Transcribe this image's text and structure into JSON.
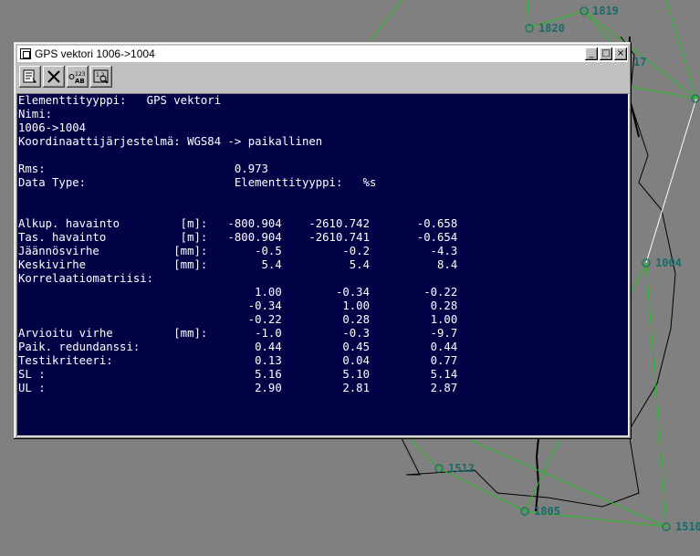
{
  "map": {
    "point_labels": [
      "1819",
      "1820",
      "17",
      "1004",
      "1512",
      "1805",
      "1510"
    ]
  },
  "window": {
    "title": "GPS vektori 1006->1004",
    "controls": {
      "minimize": "_",
      "maximize": "□",
      "close": "×"
    },
    "toolbar": {
      "buttons": [
        "properties-icon",
        "delete-icon",
        "number-format-icon",
        "zoom-to-icon"
      ],
      "format_icon_text": "123 AB"
    }
  },
  "report": {
    "lines": [
      "Elementtityyppi:   GPS vektori",
      "Nimi:",
      "1006->1004",
      "Koordinaattijärjestelmä: WGS84 -> paikallinen",
      "",
      "Rms:                            0.973",
      "Data Type:                      Elementtityyppi:   %s",
      "",
      "",
      "Alkup. havainto         [m]:   -800.904    -2610.742       -0.658",
      "Tas. havainto           [m]:   -800.904    -2610.741       -0.654",
      "Jäännösvirhe           [mm]:       -0.5         -0.2         -4.3",
      "Keskivirhe             [mm]:        5.4          5.4          8.4",
      "Korrelaatiomatriisi:",
      "                                   1.00        -0.34        -0.22",
      "                                  -0.34         1.00         0.28",
      "                                  -0.22         0.28         1.00",
      "Arvioitu virhe         [mm]:       -1.0         -0.3         -9.7",
      "Paik. redundanssi:                 0.44         0.45         0.44",
      "Testikriteeri:                     0.13         0.04         0.77",
      "SL :                               5.16         5.10         5.14",
      "UL :                               2.90         2.81         2.87"
    ]
  }
}
